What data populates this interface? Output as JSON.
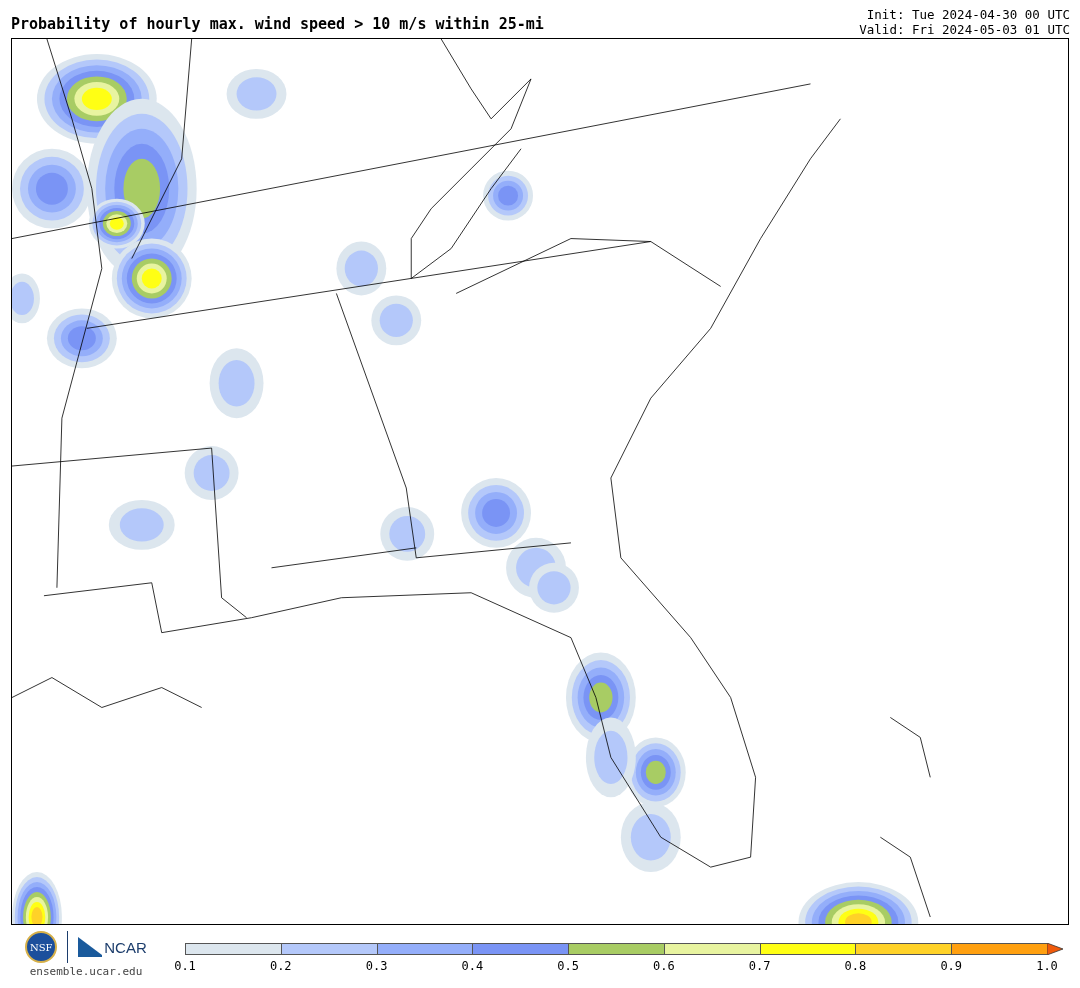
{
  "title": "Probability of hourly max. wind speed > 10 m/s within 25-mi",
  "init": "Init: Tue 2024-04-30 00 UTC",
  "valid": "Valid: Fri 2024-05-03 01 UTC",
  "footer": {
    "logo_left": "NSF",
    "logo_right": "NCAR",
    "url": "ensemble.ucar.edu"
  },
  "colorbar": {
    "segments": [
      {
        "color": "#dce6ee"
      },
      {
        "color": "#b4c8fa"
      },
      {
        "color": "#94aefa"
      },
      {
        "color": "#7a94f5"
      },
      {
        "color": "#a8cc64"
      },
      {
        "color": "#e8f4a0"
      },
      {
        "color": "#ffff14"
      },
      {
        "color": "#ffd228"
      },
      {
        "color": "#ffa010"
      }
    ],
    "arrow": {
      "color": "#f05a0a"
    },
    "ticks": [
      "0.1",
      "0.2",
      "0.3",
      "0.4",
      "0.5",
      "0.6",
      "0.7",
      "0.8",
      "0.9",
      "1.0"
    ]
  }
}
